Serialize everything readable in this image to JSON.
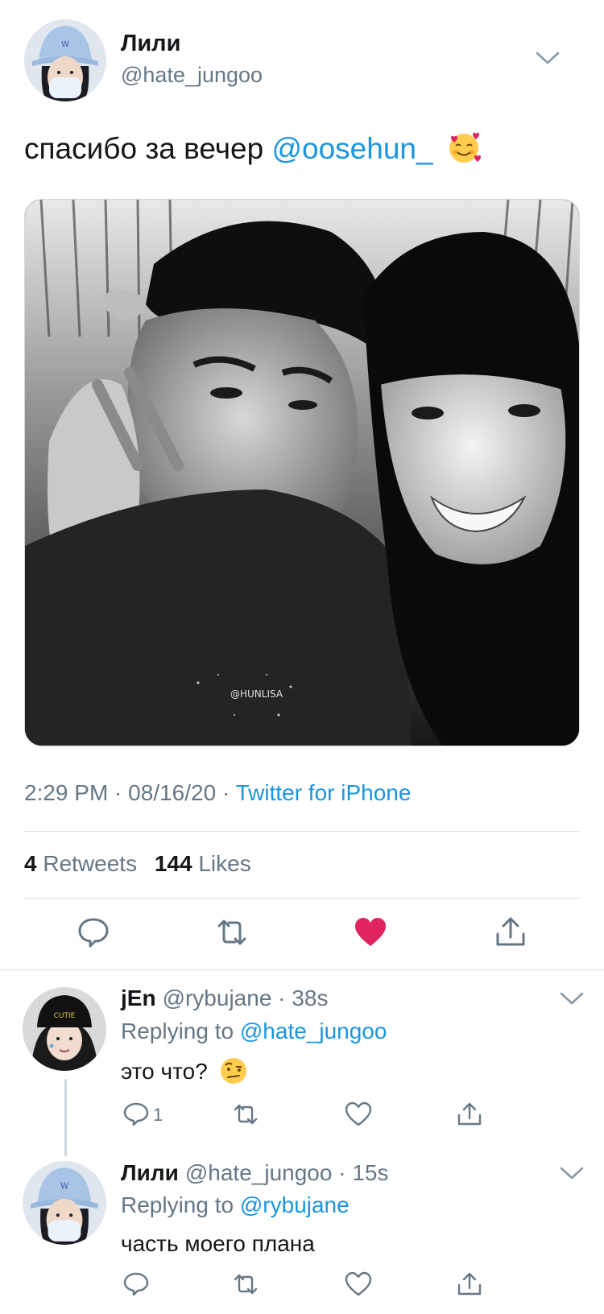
{
  "tweet": {
    "author_name": "Лили",
    "author_handle": "@hate_jungoo",
    "text": "спасибо за вечер ",
    "mention": "@oosehun_",
    "emoji": "smiling-face-with-hearts",
    "image_watermark": "@HUNLISA",
    "time": "2:29 PM",
    "date": "08/16/20",
    "source": "Twitter for iPhone",
    "retweets_count": "4",
    "retweets_label": "Retweets",
    "likes_count": "144",
    "likes_label": "Likes",
    "liked": true,
    "colors": {
      "accent": "#1b95e0",
      "like": "#e0245e",
      "muted": "#657786"
    }
  },
  "replies": [
    {
      "author_name": "jEn",
      "author_handle": "@rybujane",
      "age": "38s",
      "replying_prefix": "Replying to ",
      "replying_to": "@hate_jungoo",
      "text": "это что? ",
      "emoji": "face-with-raised-eyebrow",
      "reply_count": "1",
      "hat_text": "CUTIE"
    },
    {
      "author_name": "Лили",
      "author_handle": "@hate_jungoo",
      "age": "15s",
      "replying_prefix": "Replying to ",
      "replying_to": "@rybujane",
      "text": "часть моего плана",
      "reply_count": ""
    }
  ],
  "separator": " · "
}
